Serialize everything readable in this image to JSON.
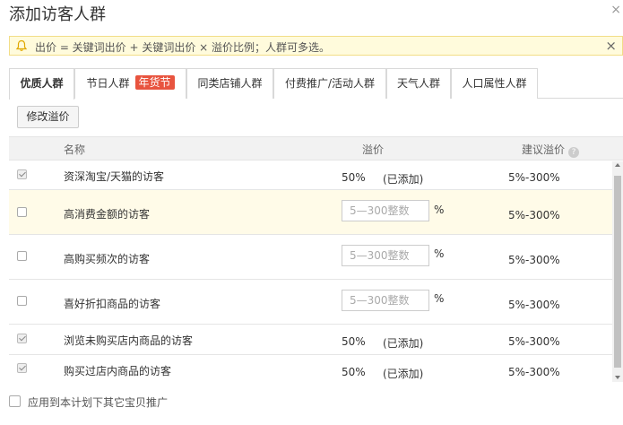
{
  "dialog": {
    "title": "添加访客人群"
  },
  "notice": {
    "text": "出价 = 关键词出价 + 关键词出价 × 溢价比例；人群可多选。"
  },
  "tabs": [
    {
      "label": "优质人群",
      "active": true
    },
    {
      "label": "节日人群",
      "badge": "年货节"
    },
    {
      "label": "同类店铺人群"
    },
    {
      "label": "付费推广/活动人群"
    },
    {
      "label": "天气人群"
    },
    {
      "label": "人口属性人群"
    }
  ],
  "toolbar": {
    "modify_label": "修改溢价"
  },
  "table": {
    "headers": {
      "name": "名称",
      "premium": "溢价",
      "suggested": "建议溢价"
    },
    "rows": [
      {
        "name": "资深淘宝/天猫的访客",
        "checked": true,
        "premium": "50%",
        "status": "(已添加)",
        "suggested": "5%-300%"
      },
      {
        "name": "高消费金额的访客",
        "checked": false,
        "placeholder": "5—300整数",
        "unit": "%",
        "suggested": "5%-300%"
      },
      {
        "name": "高购买频次的访客",
        "checked": false,
        "placeholder": "5—300整数",
        "unit": "%",
        "suggested": "5%-300%"
      },
      {
        "name": "喜好折扣商品的访客",
        "checked": false,
        "placeholder": "5—300整数",
        "unit": "%",
        "suggested": "5%-300%"
      },
      {
        "name": "浏览未购买店内商品的访客",
        "checked": true,
        "premium": "50%",
        "status": "(已添加)",
        "suggested": "5%-300%"
      },
      {
        "name": "购买过店内商品的访客",
        "checked": true,
        "premium": "50%",
        "status": "(已添加)",
        "suggested": "5%-300%"
      }
    ]
  },
  "footer": {
    "apply_label": "应用到本计划下其它宝贝推广"
  },
  "colors": {
    "badge": "#e8543f",
    "notice_bg": "#fffbdc",
    "highlight_row": "#fffbe8"
  }
}
